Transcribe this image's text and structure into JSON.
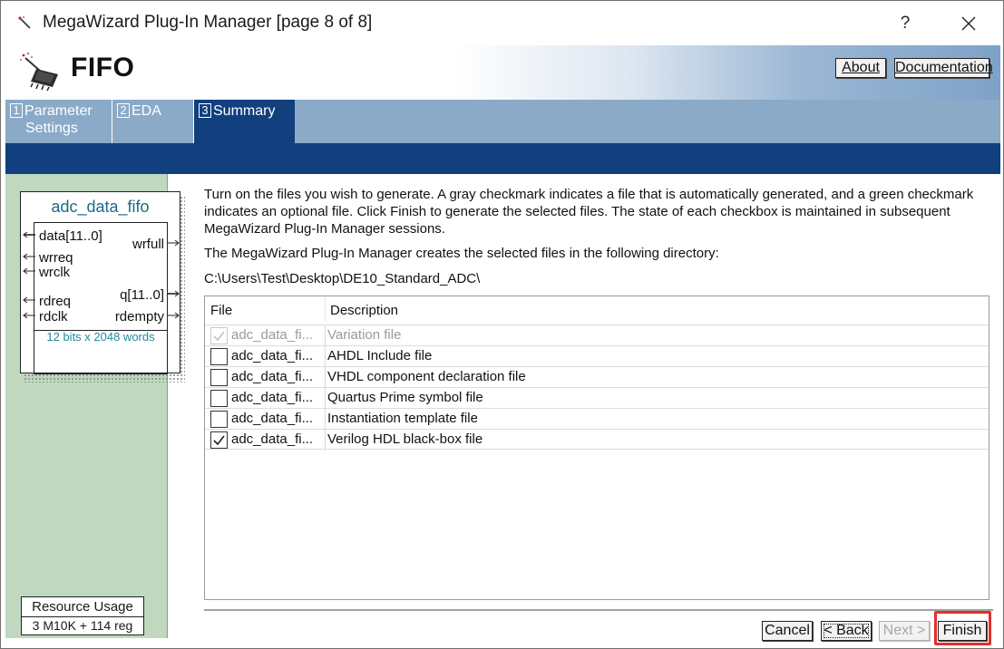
{
  "window": {
    "title": "MegaWizard Plug-In Manager [page 8 of 8]",
    "help_glyph": "?",
    "close_icon": "close-icon"
  },
  "header": {
    "title": "FIFO",
    "about_label": "About",
    "documentation_label": "Documentation"
  },
  "tabs": [
    {
      "num": "1",
      "label_line1": "Parameter",
      "label_line2": "Settings",
      "selected": false
    },
    {
      "num": "2",
      "label_line1": "EDA",
      "label_line2": "",
      "selected": false
    },
    {
      "num": "3",
      "label_line1": "Summary",
      "label_line2": "",
      "selected": true
    }
  ],
  "symbol": {
    "name": "adc_data_fifo",
    "inputs": [
      "data[11..0]",
      "wrreq",
      "wrclk",
      "rdreq",
      "rdclk"
    ],
    "outputs": [
      "wrfull",
      "q[11..0]",
      "rdempty"
    ],
    "description": "12 bits x 2048 words"
  },
  "resource": {
    "title": "Resource Usage",
    "value": "3 M10K + 114 reg"
  },
  "main": {
    "instructions": "Turn on the files you wish to generate. A gray checkmark indicates a file that is automatically generated, and a green checkmark indicates an optional file. Click Finish to generate the selected files. The state of each checkbox is maintained in subsequent MegaWizard Plug-In Manager sessions.",
    "directory_note": "The MegaWizard Plug-In Manager creates the selected files in the following directory:",
    "directory_path": "C:\\Users\\Test\\Desktop\\DE10_Standard_ADC\\"
  },
  "table": {
    "columns": [
      "File",
      "Description"
    ],
    "rows": [
      {
        "file": "adc_data_fi...",
        "description": "Variation file",
        "checked": true,
        "disabled": true
      },
      {
        "file": "adc_data_fi...",
        "description": "AHDL Include file",
        "checked": false,
        "disabled": false
      },
      {
        "file": "adc_data_fi...",
        "description": "VHDL component declaration file",
        "checked": false,
        "disabled": false
      },
      {
        "file": "adc_data_fi...",
        "description": "Quartus Prime symbol file",
        "checked": false,
        "disabled": false
      },
      {
        "file": "adc_data_fi...",
        "description": "Instantiation template file",
        "checked": false,
        "disabled": false
      },
      {
        "file": "adc_data_fi...",
        "description": "Verilog HDL black-box file",
        "checked": true,
        "disabled": false
      }
    ]
  },
  "buttons": {
    "cancel": "Cancel",
    "back": "< Back",
    "next": "Next >",
    "finish": "Finish"
  },
  "colors": {
    "accent_dark": "#123f7e",
    "tab_light": "#8aaac8",
    "left_panel": "#c0d8c0",
    "highlight": "#e0302c"
  }
}
